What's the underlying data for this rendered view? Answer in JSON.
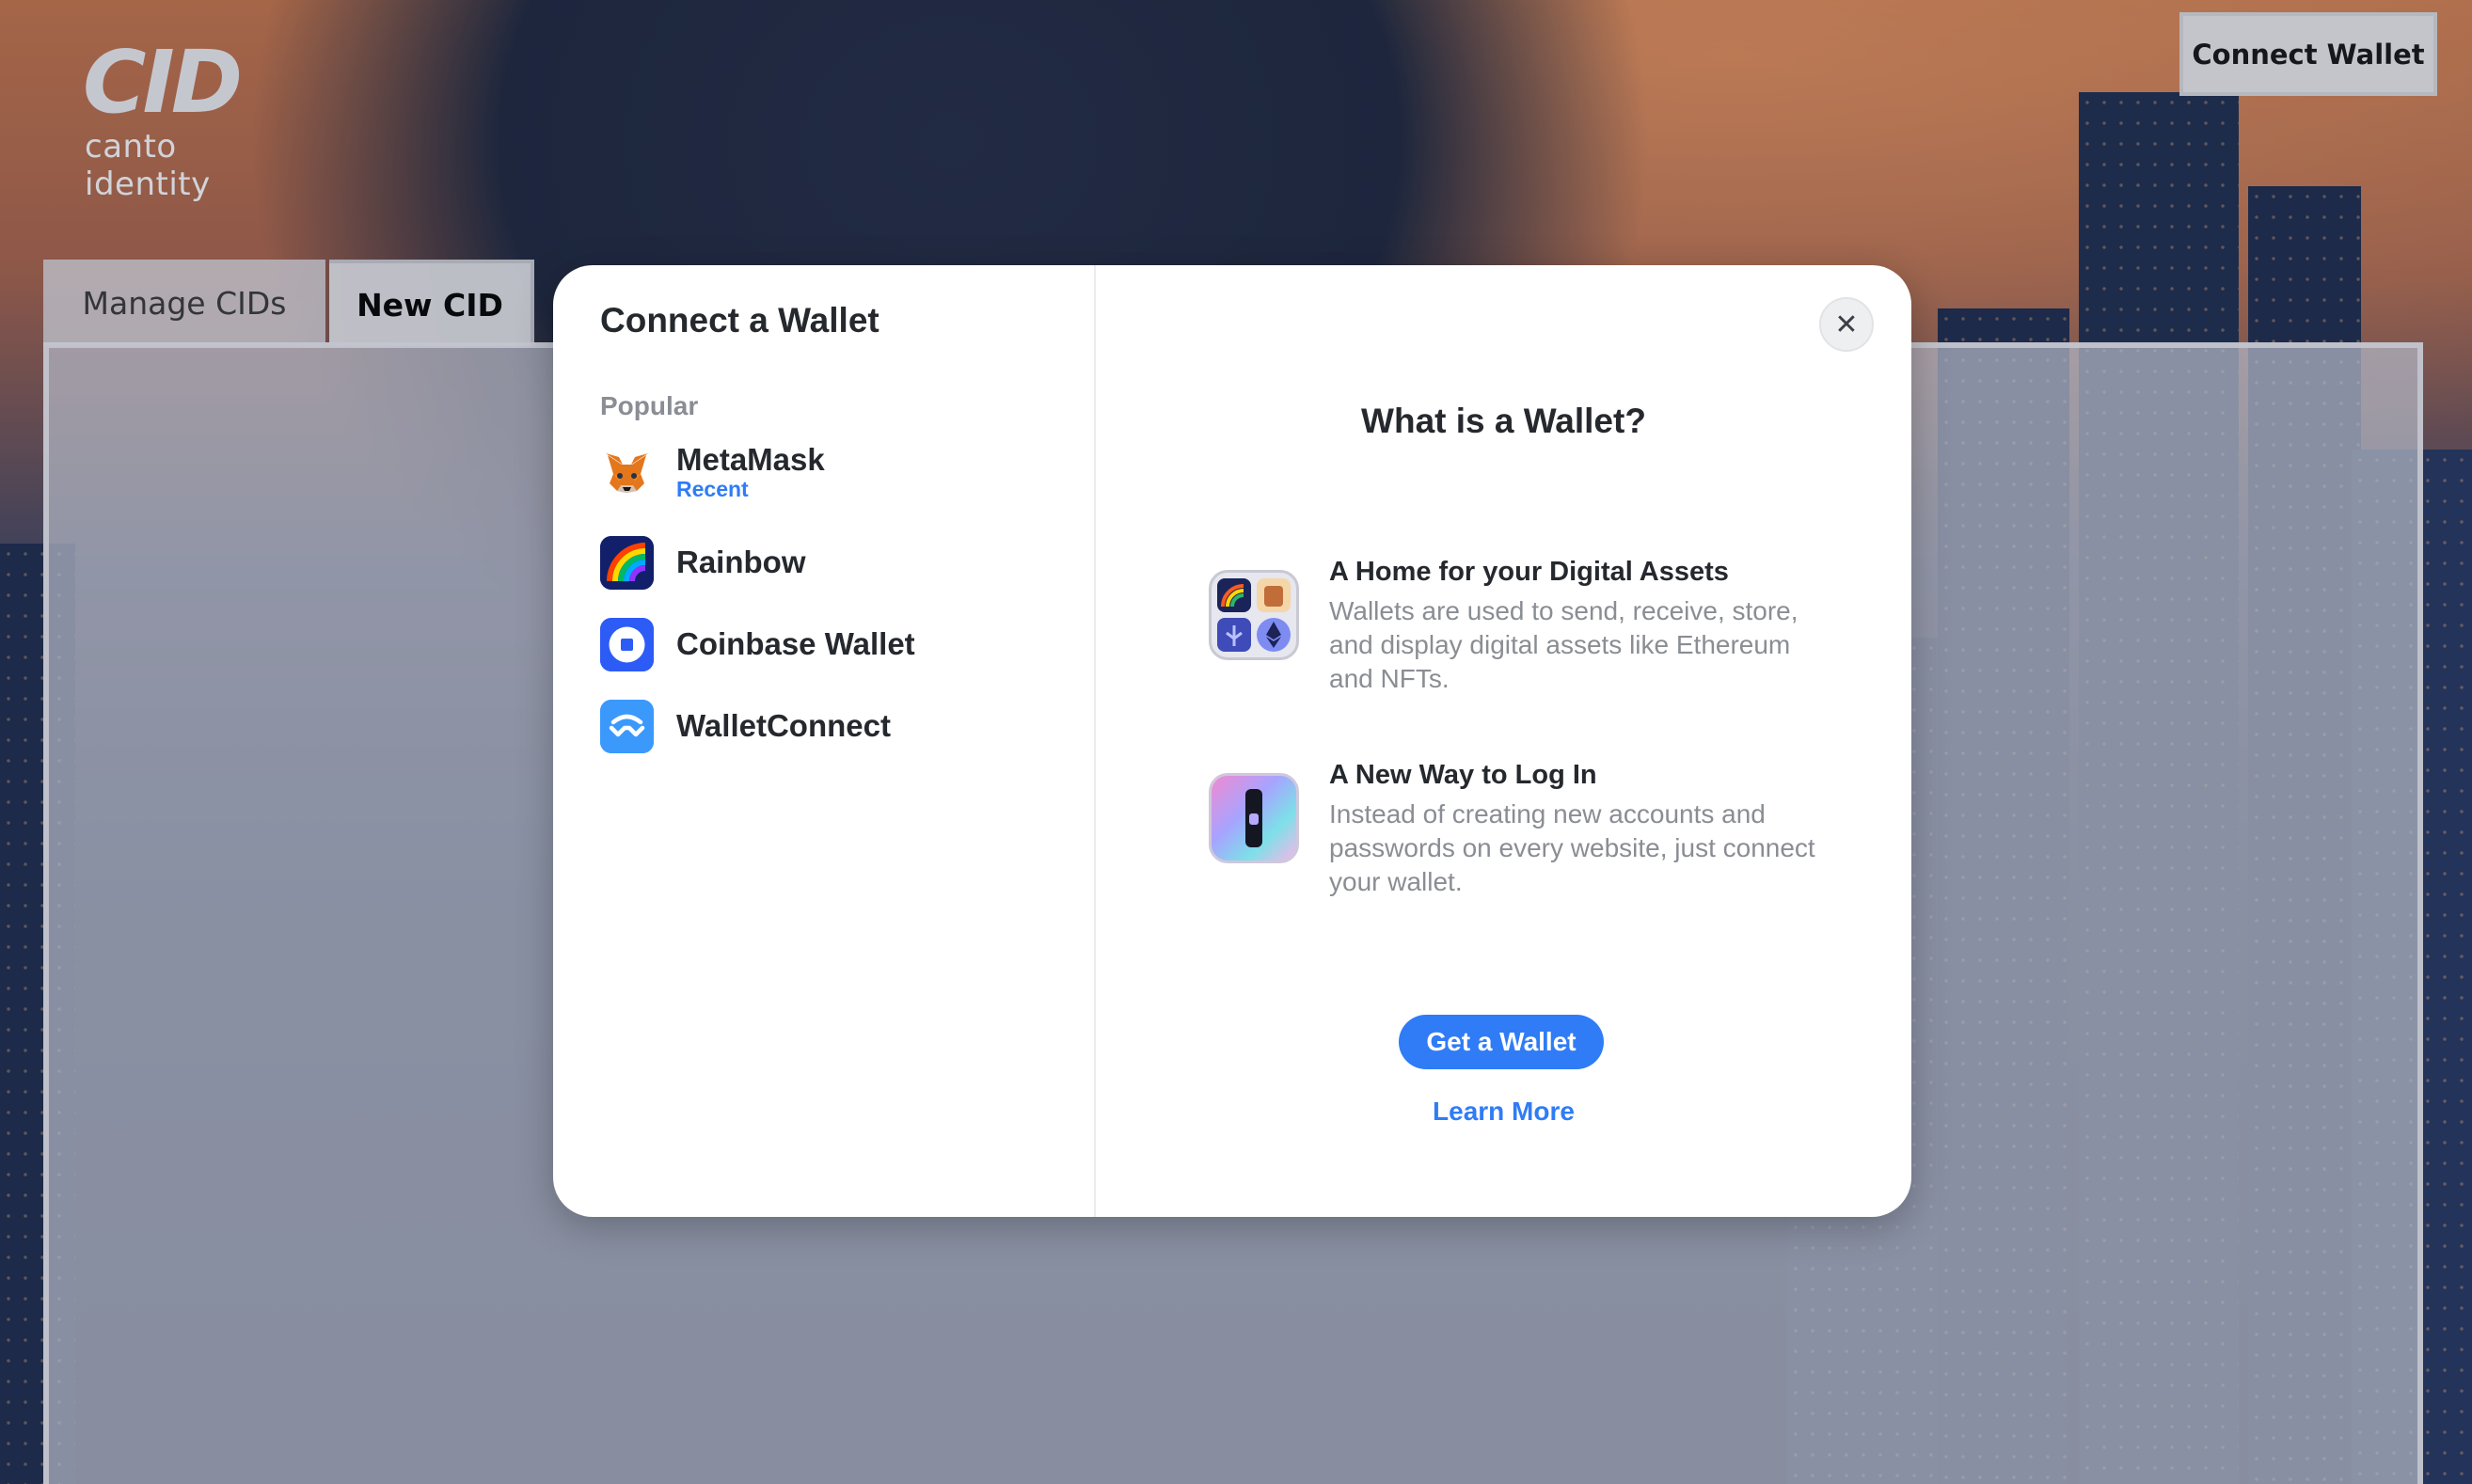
{
  "app": {
    "logo_text": "canto identity",
    "connect_button": "Connect Wallet"
  },
  "tabs": [
    {
      "label": "Manage CIDs"
    },
    {
      "label": "New CID"
    }
  ],
  "modal": {
    "title": "Connect a Wallet",
    "section_label": "Popular",
    "wallets": [
      {
        "name": "MetaMask",
        "tag": "Recent",
        "icon": "metamask-fox-icon"
      },
      {
        "name": "Rainbow",
        "icon": "rainbow-icon"
      },
      {
        "name": "Coinbase Wallet",
        "icon": "coinbase-icon"
      },
      {
        "name": "WalletConnect",
        "icon": "walletconnect-icon"
      }
    ],
    "close_icon": "close-icon",
    "info": {
      "title": "What is a Wallet?",
      "features": [
        {
          "title": "A Home for your Digital Assets",
          "description": "Wallets are used to send, receive, store, and display digital assets like Ethereum and NFTs."
        },
        {
          "title": "A New Way to Log In",
          "description": "Instead of creating new accounts and passwords on every website, just connect your wallet."
        }
      ],
      "get_wallet": "Get a Wallet",
      "learn_more": "Learn More"
    }
  },
  "colors": {
    "accent": "#2f7cf6",
    "modal_text": "#25292e",
    "muted_text": "#8a8d93"
  }
}
